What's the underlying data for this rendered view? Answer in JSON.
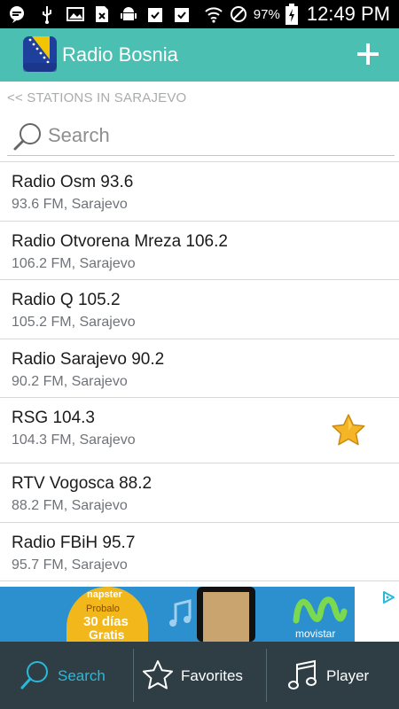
{
  "status_bar": {
    "battery_percent": "97%",
    "time": "12:49 PM"
  },
  "app_bar": {
    "title": "Radio Bosnia"
  },
  "breadcrumb": "<< STATIONS IN SARAJEVO",
  "search": {
    "placeholder": "Search",
    "value": ""
  },
  "stations": [
    {
      "name": "Radio Osm 93.6",
      "subtitle": "93.6 FM, Sarajevo",
      "favorite": false
    },
    {
      "name": "Radio Otvorena Mreza 106.2",
      "subtitle": "106.2 FM, Sarajevo",
      "favorite": false
    },
    {
      "name": "Radio Q 105.2",
      "subtitle": "105.2 FM, Sarajevo",
      "favorite": false
    },
    {
      "name": "Radio Sarajevo 90.2",
      "subtitle": "90.2 FM, Sarajevo",
      "favorite": false
    },
    {
      "name": "RSG 104.3",
      "subtitle": "104.3 FM, Sarajevo",
      "favorite": true
    },
    {
      "name": "RTV Vogosca 88.2",
      "subtitle": "88.2 FM, Sarajevo",
      "favorite": false
    },
    {
      "name": "Radio FBiH 95.7",
      "subtitle": "95.7 FM, Sarajevo",
      "favorite": false
    }
  ],
  "ad": {
    "brand": "napster",
    "line1": "Probalo",
    "line2": "30 días",
    "line3": "Gratis",
    "advertiser": "movistar"
  },
  "bottom_nav": {
    "tabs": [
      {
        "label": "Search",
        "icon": "search-icon",
        "active": true
      },
      {
        "label": "Favorites",
        "icon": "star-icon",
        "active": false
      },
      {
        "label": "Player",
        "icon": "music-note-icon",
        "active": false
      }
    ]
  },
  "colors": {
    "app_bar": "#4bbfb2",
    "nav_bg": "#2f3e45",
    "nav_active": "#2ab9d9",
    "nav_inactive": "#ffffff",
    "favorite_star": "#f6b526"
  }
}
